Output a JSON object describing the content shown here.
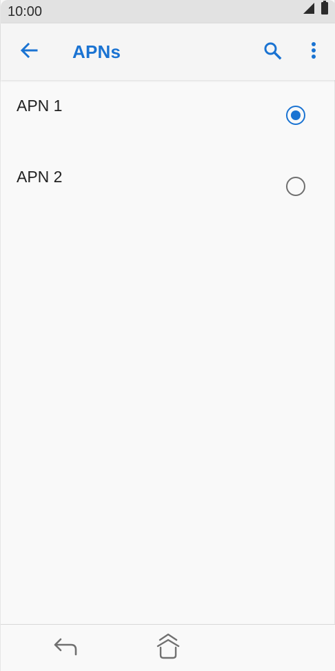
{
  "status_bar": {
    "time": "10:00",
    "icons": [
      "cell-signal-icon",
      "battery-icon"
    ]
  },
  "app_bar": {
    "title": "APNs",
    "back_icon": "arrow-back-icon",
    "search_icon": "search-icon",
    "more_icon": "more-vert-icon"
  },
  "apns": [
    {
      "label": "APN 1",
      "selected": true
    },
    {
      "label": "APN 2",
      "selected": false
    }
  ],
  "nav_bar": {
    "back_icon": "nav-back-icon",
    "home_icon": "nav-home-icon"
  },
  "colors": {
    "accent": "#1a73d2",
    "text": "#222222",
    "status_bar_bg": "#e2e2e2",
    "radio_unchecked": "#6f6f6f"
  }
}
